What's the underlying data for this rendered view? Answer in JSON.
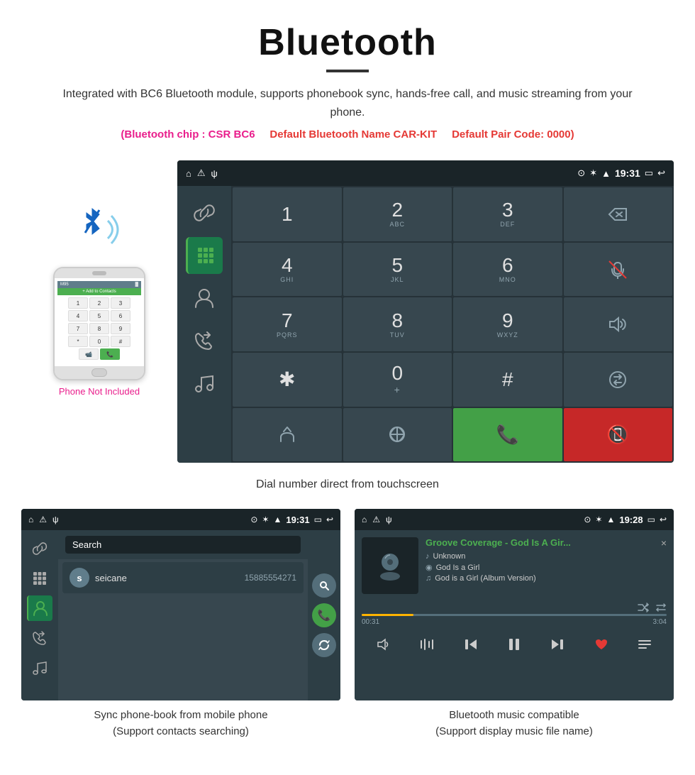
{
  "header": {
    "title": "Bluetooth",
    "description": "Integrated with BC6 Bluetooth module, supports phonebook sync, hands-free call, and music streaming from your phone.",
    "specs": {
      "chip": "(Bluetooth chip : CSR BC6",
      "name": "Default Bluetooth Name CAR-KIT",
      "code": "Default Pair Code: 0000)"
    }
  },
  "dial_screen": {
    "status_time": "19:31",
    "keys": [
      {
        "main": "1",
        "sub": ""
      },
      {
        "main": "2",
        "sub": "ABC"
      },
      {
        "main": "3",
        "sub": "DEF"
      },
      {
        "main": "⌫",
        "sub": "",
        "type": "backspace"
      },
      {
        "main": "4",
        "sub": "GHI"
      },
      {
        "main": "5",
        "sub": "JKL"
      },
      {
        "main": "6",
        "sub": "MNO"
      },
      {
        "main": "🎤",
        "sub": "",
        "type": "mute"
      },
      {
        "main": "7",
        "sub": "PQRS"
      },
      {
        "main": "8",
        "sub": "TUV"
      },
      {
        "main": "9",
        "sub": "WXYZ"
      },
      {
        "main": "🔊",
        "sub": "",
        "type": "volume"
      },
      {
        "main": "✱",
        "sub": ""
      },
      {
        "main": "0",
        "sub": "+"
      },
      {
        "main": "#",
        "sub": ""
      },
      {
        "main": "⇅",
        "sub": "",
        "type": "swap"
      },
      {
        "main": "⇧",
        "sub": "",
        "type": "merge"
      },
      {
        "main": "⇄",
        "sub": "",
        "type": "dtmf"
      },
      {
        "main": "📞",
        "sub": "",
        "type": "call"
      },
      {
        "main": "📵",
        "sub": "",
        "type": "end"
      }
    ]
  },
  "dial_caption": "Dial number direct from touchscreen",
  "phone_not_included": "Phone Not Included",
  "phonebook_screen": {
    "status_time": "19:31",
    "search_placeholder": "Search",
    "contact": {
      "initial": "s",
      "name": "seicane",
      "number": "15885554271"
    }
  },
  "phonebook_caption": "Sync phone-book from mobile phone\n(Support contacts searching)",
  "music_screen": {
    "status_time": "19:28",
    "close_label": "×",
    "song_title": "Groove Coverage - God Is A Gir...",
    "artist": "Unknown",
    "album": "God Is a Girl",
    "track": "God is a Girl (Album Version)",
    "time_current": "00:31",
    "time_total": "3:04",
    "progress_percent": 17
  },
  "music_caption": "Bluetooth music compatible\n(Support display music file name)"
}
